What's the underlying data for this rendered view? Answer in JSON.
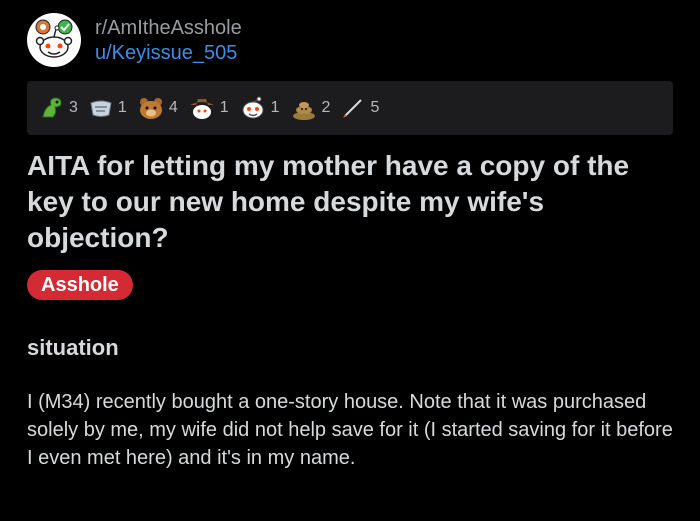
{
  "post": {
    "subreddit": "r/AmItheAsshole",
    "username": "u/Keyissue_505",
    "title": "AITA for letting my mother have a copy of the key to our new home despite my wife's objection?",
    "flair": "Asshole",
    "section_heading": "situation",
    "body": "I (M34) recently bought a one-story house. Note that it was purchased solely by me, my wife did not help save for it (I started saving for it before I even met here) and it's in my name."
  },
  "awards": [
    {
      "icon": "green-dino-award-icon",
      "count": "3"
    },
    {
      "icon": "wind-face-award-icon",
      "count": "1"
    },
    {
      "icon": "bear-award-icon",
      "count": "4"
    },
    {
      "icon": "cowboy-snoo-award-icon",
      "count": "1"
    },
    {
      "icon": "snoo-face-award-icon",
      "count": "1"
    },
    {
      "icon": "poop-award-icon",
      "count": "2"
    },
    {
      "icon": "pen-award-icon",
      "count": "5"
    }
  ],
  "colors": {
    "background": "#000000",
    "username": "#3d8ee6",
    "flair_bg": "#d42a33",
    "award_bar": "#1c1c1e"
  }
}
